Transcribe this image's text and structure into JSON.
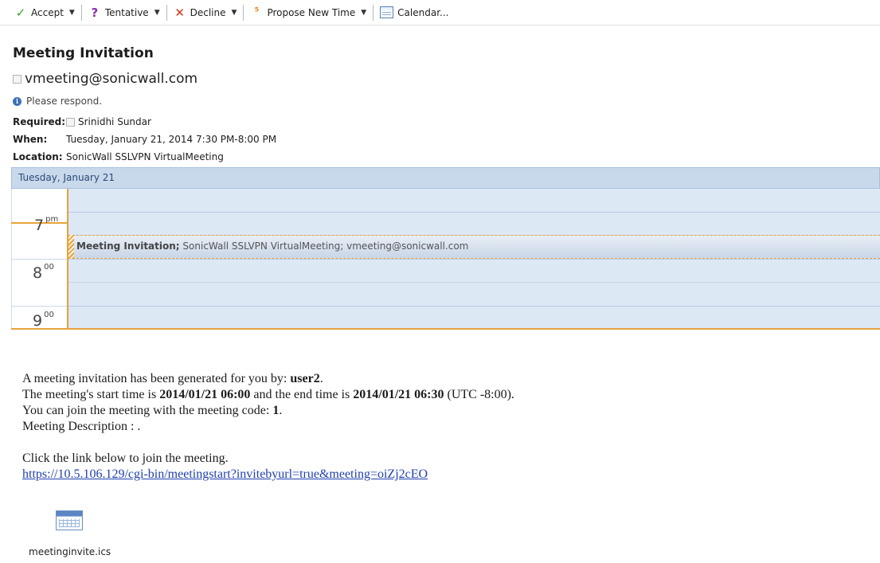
{
  "toolbar": {
    "accept": "Accept",
    "tentative": "Tentative",
    "decline": "Decline",
    "propose": "Propose New Time",
    "calendar": "Calendar..."
  },
  "message": {
    "subject": "Meeting Invitation",
    "sender": "vmeeting@sonicwall.com",
    "notice": "Please respond.",
    "required_label": "Required:",
    "required_value": "Srinidhi Sundar",
    "when_label": "When:",
    "when_value": "Tuesday, January 21, 2014 7:30 PM-8:00 PM",
    "location_label": "Location:",
    "location_value": "SonicWall SSLVPN VirtualMeeting"
  },
  "calendar": {
    "day_header": "Tuesday, January 21",
    "times": [
      {
        "hour": "7",
        "suffix": "pm"
      },
      {
        "hour": "8",
        "suffix": "00"
      },
      {
        "hour": "9",
        "suffix": "00"
      }
    ],
    "appointment_title": "Meeting Invitation;",
    "appointment_details": "SonicWall SSLVPN VirtualMeeting; vmeeting@sonicwall.com",
    "colors": {
      "accent": "#e7a33c",
      "header": "#c9d9ec",
      "grid": "#dde8f5"
    }
  },
  "body": {
    "line1_prefix": "A meeting invitation has been generated for you by: ",
    "line1_user": "user2",
    "line1_suffix": ".",
    "line2_prefix": "The meeting's start time is ",
    "start_time": "2014/01/21 06:00",
    "line2_mid": " and the end time is ",
    "end_time": "2014/01/21 06:30",
    "line2_suffix": " (UTC -8:00).",
    "line3_prefix": "You can join the meeting with the meeting code: ",
    "meeting_code": "1",
    "line3_suffix": ".",
    "line4": "Meeting Description : .",
    "line5": "Click the link below to join the meeting.",
    "link": "https://10.5.106.129/cgi-bin/meetingstart?invitebyurl=true&meeting=oiZj2cEO"
  },
  "attachment": {
    "filename": "meetinginvite.ics"
  }
}
